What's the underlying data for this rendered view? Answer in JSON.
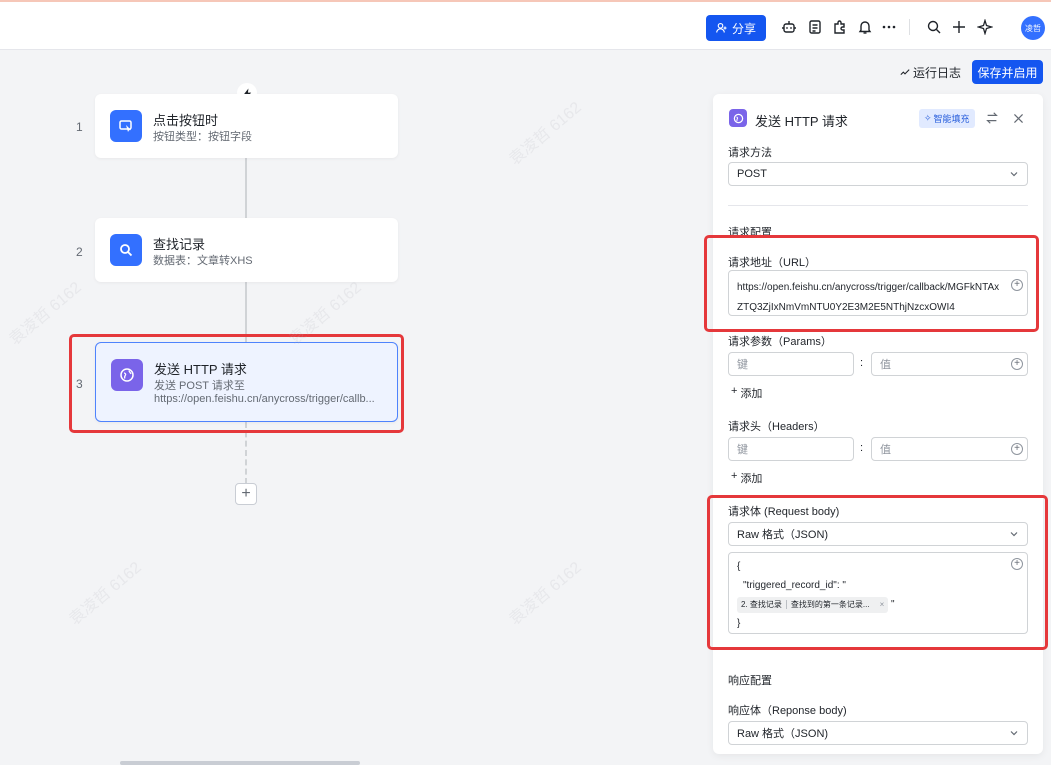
{
  "topbar": {
    "share_label": "分享",
    "avatar_text": "凌哲",
    "icons": [
      "robot-icon",
      "form-icon",
      "plugin-icon",
      "bell-icon",
      "more-icon",
      "search-icon",
      "plus-icon",
      "sparkle-icon"
    ]
  },
  "toolbar": {
    "run_log_label": "运行日志",
    "save_enable_label": "保存并启用"
  },
  "flow": {
    "nodes": [
      {
        "num": "1",
        "title": "点击按钮时",
        "sub": "按钮类型：按钮字段",
        "sub2": ""
      },
      {
        "num": "2",
        "title": "查找记录",
        "sub": "数据表：文章转XHS",
        "sub2": ""
      },
      {
        "num": "3",
        "title": "发送 HTTP 请求",
        "sub": "发送 POST 请求至",
        "sub2": "https://open.feishu.cn/anycross/trigger/callb..."
      }
    ]
  },
  "panel": {
    "title": "发送 HTTP 请求",
    "smart_fill": "智能填充",
    "method_label": "请求方法",
    "method_value": "POST",
    "config_label": "请求配置",
    "url_label": "请求地址（URL）",
    "url_value": "https://open.feishu.cn/anycross/trigger/callback/MGFkNTAxZTQ3ZjIxNmVmNTU0Y2E3M2E5NThjNzcxOWI4",
    "params_label": "请求参数（Params）",
    "params_key_placeholder": "键",
    "params_value_placeholder": "值",
    "params_add": "添加",
    "headers_label": "请求头（Headers）",
    "headers_key_placeholder": "键",
    "headers_value_placeholder": "值",
    "headers_add": "添加",
    "body_label": "请求体 (Request body)",
    "body_format": "Raw 格式（JSON)",
    "body_line1": "{",
    "body_line2": "\"triggered_record_id\": \"",
    "body_chip_step": "2. 查找记录",
    "body_chip_field": "查找到的第一条记录...",
    "body_after_chip": "\"",
    "body_line4": "}",
    "response_config_label": "响应配置",
    "response_body_label": "响应体（Reponse body)",
    "response_format": "Raw 格式（JSON)"
  },
  "watermark": "袁凌哲 6162"
}
